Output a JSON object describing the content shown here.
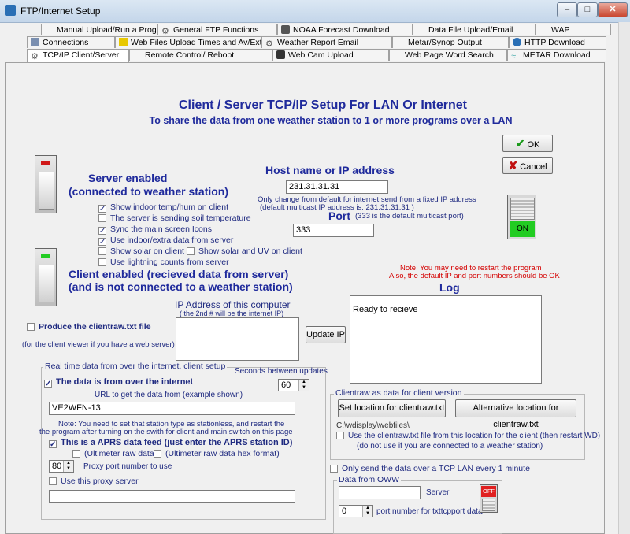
{
  "window": {
    "title": "FTP/Internet Setup"
  },
  "tabs_row1": [
    "Manual Upload/Run a Program",
    "General FTP Functions",
    "NOAA Forecast Download",
    "Data File Upload/Email",
    "WAP"
  ],
  "tabs_row2": [
    "Connections",
    "Web Files Upload Times and Av/Ext",
    "Weather Report Email",
    "Metar/Synop Output",
    "HTTP Download"
  ],
  "tabs_row3": [
    "TCP/IP Client/Server",
    "Remote Control/ Reboot",
    "Web Cam Upload",
    "Web Page Word Search",
    "METAR Download"
  ],
  "header": {
    "title": "Client / Server TCP/IP Setup For LAN Or Internet",
    "subtitle": "To share the data from one weather station to 1 or more programs over a LAN"
  },
  "buttons": {
    "ok": "OK",
    "cancel": "Cancel",
    "update_ip": "Update IP",
    "set_location": "Set location for clientraw.txt",
    "alt_location": "Alternative location for clientraw.txt"
  },
  "server": {
    "heading_1": "Server enabled",
    "heading_2": "(connected to weather station)"
  },
  "host": {
    "label": "Host name or IP address",
    "value": "231.31.31.31",
    "note_1": "Only change from default for internet send from a fixed IP address",
    "note_2": "(default multicast  IP address is: 231.31.31.31 )"
  },
  "port": {
    "label": "Port",
    "note": "(333 is the default multicast port)",
    "value": "333"
  },
  "on_switch": {
    "label": "ON"
  },
  "server_options": [
    {
      "label": "Show indoor temp/hum on client",
      "checked": true
    },
    {
      "label": "The server is sending soil temperature",
      "checked": false
    },
    {
      "label": "Sync the main screen Icons",
      "checked": true
    },
    {
      "label": "Use indoor/extra data from server",
      "checked": true
    },
    {
      "label": "Show solar on client",
      "checked": false
    },
    {
      "label": "Show solar and UV on client",
      "checked": false
    },
    {
      "label": "Use lightning counts from server",
      "checked": false
    }
  ],
  "client": {
    "heading_1": "Client enabled (recieved data from server)",
    "heading_2": "(and is not connected to a weather station)"
  },
  "restart_note": {
    "line_1": "Note: You may need to restart the program",
    "line_2": "Also, the default IP and port numbers should be OK"
  },
  "ip_box": {
    "label": "IP Address of this computer",
    "sublabel": "( the 2nd # will be the internet IP)"
  },
  "log": {
    "label": "Log",
    "text": "Ready to recieve"
  },
  "clientraw": {
    "checkbox": "Produce the clientraw.txt file",
    "note": "(for the client viewer if you have a web server)"
  },
  "realtime": {
    "group_label": "Real time data from over the internet, client setup",
    "seconds_label": "Seconds between updates",
    "seconds_value": "60",
    "internet_check": "The data is from over the internet",
    "url_label": "URL to get the data from (example shown)",
    "url_value": "VE2WFN-13",
    "note_1": "Note: You need to set that station type as stationless, and restart the",
    "note_2": "the program after turning on the swith for client and main switch on this page",
    "aprs_check": "This is a APRS data feed (just enter the APRS station ID)",
    "ultimeter_raw": "(Ultimeter raw data)",
    "ultimeter_hex": "(Ultimeter raw data hex format)",
    "proxy_port_value": "80",
    "proxy_port_label": "Proxy port number to use",
    "proxy_check": "Use this proxy server",
    "proxy_value": ""
  },
  "clientraw_group": {
    "label": "Clientraw as data for client version",
    "path": "C:\\wdisplay\\webfiles\\",
    "use_check_1": "Use the clientraw.txt file from this location for the client (then restart WD)",
    "use_check_2": "(do not use if you are connected to a weather station)"
  },
  "tcp_lan": {
    "label": "Only send the data over a TCP LAN every 1 minute"
  },
  "oww": {
    "label": "Data from OWW",
    "server_label": "Server",
    "server_value": "",
    "port_value": "0",
    "port_label": "port number for txttcpport data",
    "switch_label": "OFF"
  },
  "colors": {
    "title_blue": "#1f2a9c",
    "on_green": "#22cc22",
    "off_red": "#e02020",
    "note_red": "#d40000"
  }
}
